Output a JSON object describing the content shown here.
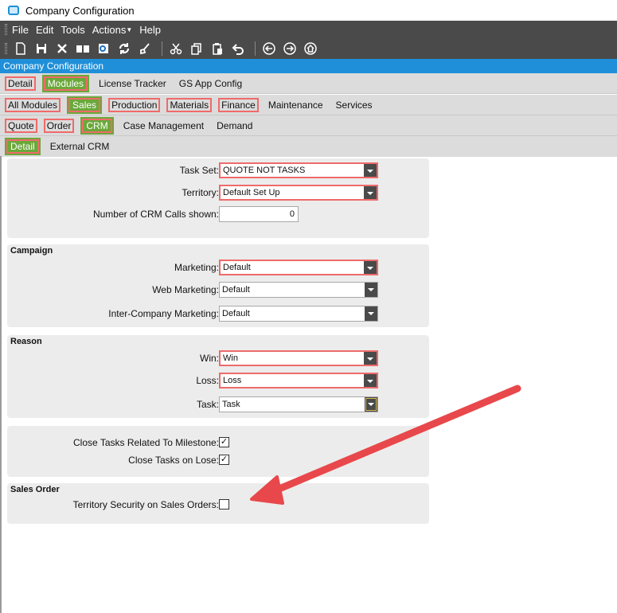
{
  "window": {
    "title": "Company Configuration"
  },
  "menu": [
    "File",
    "Edit",
    "Tools",
    "Actions",
    "Help"
  ],
  "toolbar": {
    "icons": [
      "new-icon",
      "save-icon",
      "delete-icon",
      "open-book-icon",
      "outlook-icon",
      "refresh-icon",
      "clear-icon",
      "cut-icon",
      "copy-icon",
      "paste-icon",
      "undo-icon",
      "back-icon",
      "forward-icon",
      "home-icon"
    ]
  },
  "form_title": "Company Configuration",
  "tabs": {
    "row1": [
      "Detail",
      "Modules",
      "License Tracker",
      "GS App Config"
    ],
    "row2": [
      "All Modules",
      "Sales",
      "Production",
      "Materials",
      "Finance",
      "Maintenance",
      "Services"
    ],
    "row3": [
      "Quote",
      "Order",
      "CRM",
      "Case Management",
      "Demand"
    ],
    "row4": [
      "Detail",
      "External CRM"
    ]
  },
  "general": {
    "task_set_label": "Task Set:",
    "task_set_value": "QUOTE NOT TASKS",
    "territory_label": "Territory:",
    "territory_value": "Default Set Up",
    "crm_calls_label": "Number of CRM Calls shown:",
    "crm_calls_value": "0"
  },
  "campaign": {
    "title": "Campaign",
    "marketing_label": "Marketing:",
    "marketing_value": "Default",
    "web_marketing_label": "Web Marketing:",
    "web_marketing_value": "Default",
    "inter_company_label": "Inter-Company Marketing:",
    "inter_company_value": "Default"
  },
  "reason": {
    "title": "Reason",
    "win_label": "Win:",
    "win_value": "Win",
    "loss_label": "Loss:",
    "loss_value": "Loss",
    "task_label": "Task:",
    "task_value": "Task"
  },
  "milestone": {
    "close_related_label": "Close Tasks Related To Milestone:",
    "close_related_checked": true,
    "close_on_lose_label": "Close Tasks on Lose:",
    "close_on_lose_checked": true
  },
  "sales_order": {
    "title": "Sales Order",
    "territory_security_label": "Territory Security on Sales Orders:",
    "territory_security_checked": false
  },
  "colors": {
    "accent_blue": "#1f8fd9",
    "active_tab_green": "#6aa83a",
    "required_red": "#ef6a6a",
    "annotation_arrow": "#e8484b"
  }
}
